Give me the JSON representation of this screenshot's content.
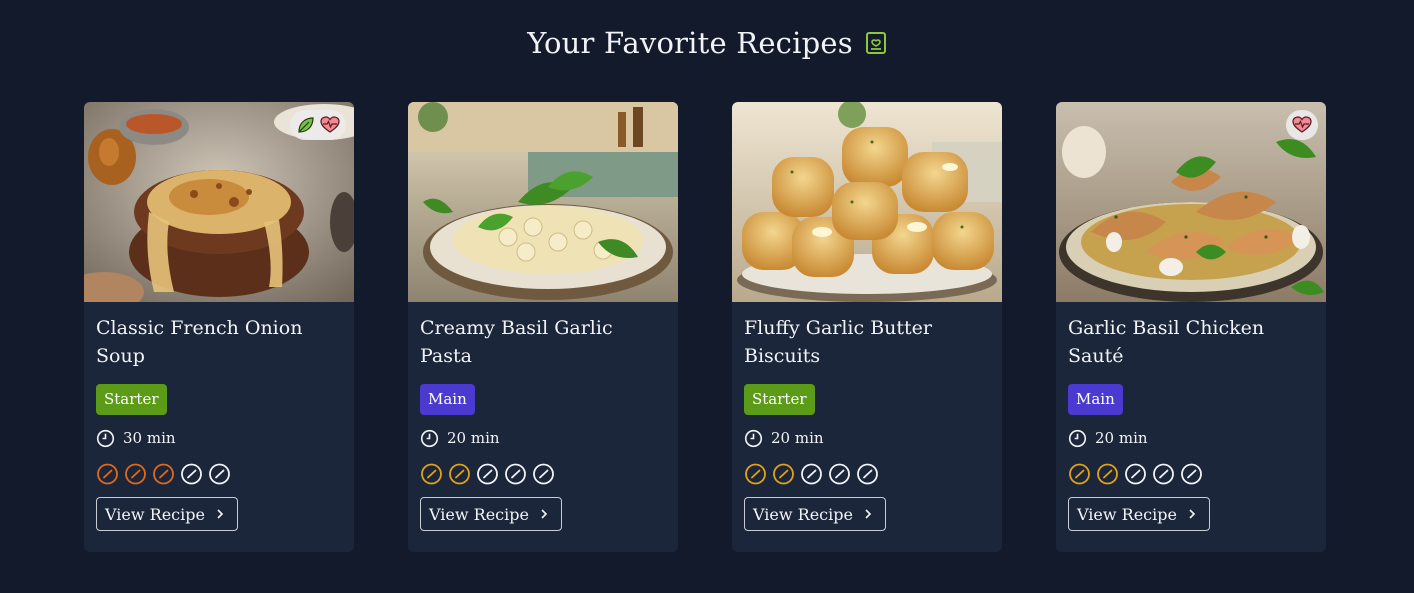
{
  "page": {
    "title": "Your Favorite Recipes",
    "title_icon": "recipe-book-icon",
    "accent": "#8ec63f"
  },
  "cards": [
    {
      "title": "Classic French Onion Soup",
      "category": "Starter",
      "time": "30 min",
      "difficulty": 3,
      "difficulty_max": 5,
      "difficulty_color": "#e06a1b",
      "flags": [
        "vegetarian-leaf-icon",
        "heart-health-icon"
      ],
      "button_label": "View Recipe"
    },
    {
      "title": "Creamy Basil Garlic Pasta",
      "category": "Main",
      "time": "20 min",
      "difficulty": 2,
      "difficulty_max": 5,
      "difficulty_color": "#e0a21b",
      "flags": [],
      "button_label": "View Recipe"
    },
    {
      "title": "Fluffy Garlic Butter Biscuits",
      "category": "Starter",
      "time": "20 min",
      "difficulty": 2,
      "difficulty_max": 5,
      "difficulty_color": "#e0a21b",
      "flags": [],
      "button_label": "View Recipe"
    },
    {
      "title": "Garlic Basil Chicken Sauté",
      "category": "Main",
      "time": "20 min",
      "difficulty": 2,
      "difficulty_max": 5,
      "difficulty_color": "#e0a21b",
      "flags": [
        "heart-health-icon"
      ],
      "button_label": "View Recipe"
    }
  ],
  "colors": {
    "background": "#121a2b",
    "card": "#1c263a",
    "starter_badge": "#5b9b17",
    "main_badge": "#4a3ad0"
  }
}
